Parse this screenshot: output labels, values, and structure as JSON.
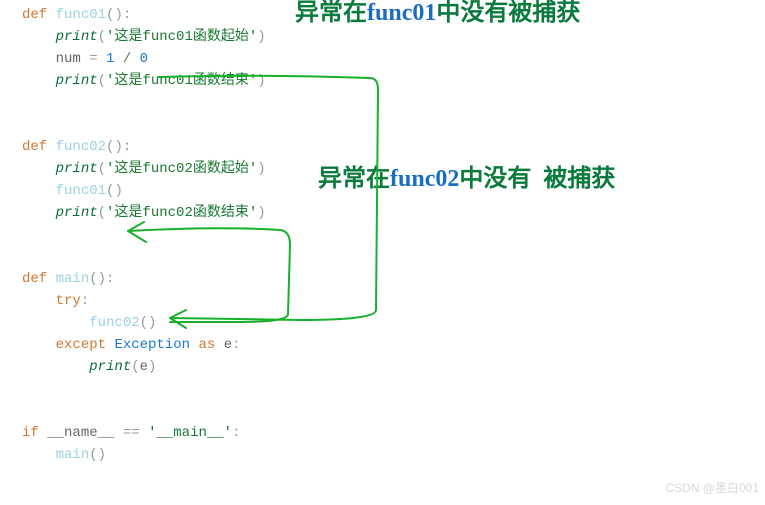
{
  "code": {
    "def": "def",
    "try": "try",
    "except": "except",
    "as": "as",
    "if": "if",
    "print": "print",
    "func01": "func01",
    "func02": "func02",
    "main": "main",
    "exception": "Exception",
    "name_dunder": "__name__",
    "main_dunder": "'__main__'",
    "str_f01_start": "'这是func01函数起始'",
    "str_f01_end": "'这是func01函数结束'",
    "str_f02_start": "'这是func02函数起始'",
    "str_f02_end": "'这是func02函数结束'",
    "num_var": "num",
    "e_var": "e",
    "one": "1",
    "zero": "0",
    "eq": "=",
    "eqeq": "==",
    "slash": "/",
    "lp": "(",
    "rp": ")",
    "colon": ":"
  },
  "annotations": {
    "line1_pre": "异常在",
    "line1_fn": "func01",
    "line1_post": "中没有被捕获",
    "line2_pre": "异常在",
    "line2_fn": "func02",
    "line2_mid": "中没有",
    "line2_post": "被捕获"
  },
  "watermark": "CSDN @墨白001"
}
